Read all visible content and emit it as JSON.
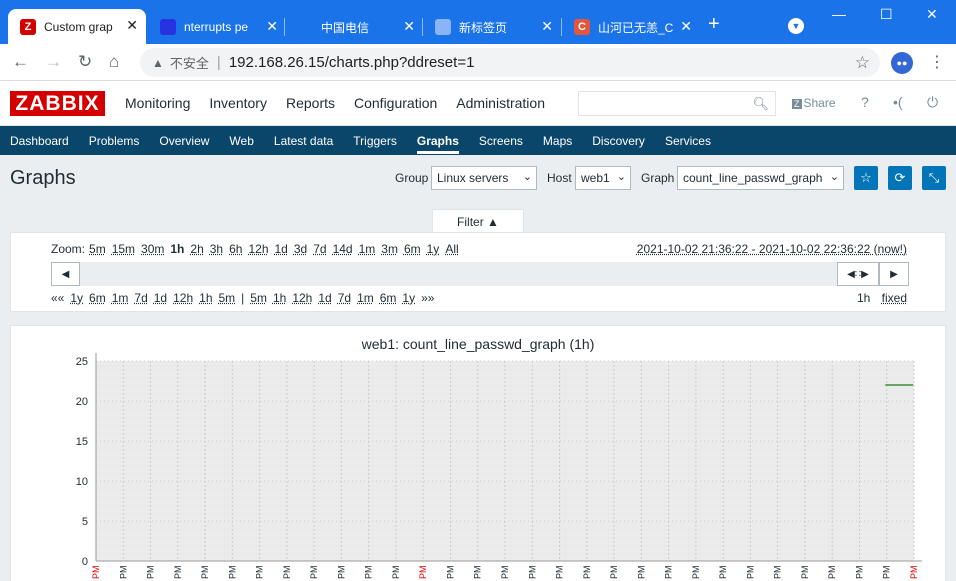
{
  "browser": {
    "tabs": [
      {
        "title": "Custom grap",
        "icon": "zabbix-z-icon",
        "icon_text": "Z",
        "icon_color": "#d40000",
        "active": true
      },
      {
        "title": "nterrupts pe",
        "icon": "baidu-paw-icon",
        "icon_text": "",
        "icon_color": "#2932e1",
        "active": false
      },
      {
        "title": "中国电信",
        "icon": "telecom-icon",
        "icon_text": "",
        "icon_color": "#1a73e8",
        "active": false
      },
      {
        "title": "新标签页",
        "icon": "chrome-newtab-icon",
        "icon_text": "",
        "icon_color": "#8ab4f8",
        "active": false
      },
      {
        "title": "山河已无恙_C",
        "icon": "csdn-c-icon",
        "icon_text": "C",
        "icon_color": "#e3563b",
        "active": false
      }
    ],
    "address": {
      "insecure_label": "不安全",
      "url": "192.168.26.15/charts.php?ddreset=1"
    }
  },
  "zabbix": {
    "logo": "ZABBIX",
    "main_menu": [
      "Monitoring",
      "Inventory",
      "Reports",
      "Configuration",
      "Administration"
    ],
    "share": "Share",
    "sub_menu": [
      "Dashboard",
      "Problems",
      "Overview",
      "Web",
      "Latest data",
      "Triggers",
      "Graphs",
      "Screens",
      "Maps",
      "Discovery",
      "Services"
    ],
    "selected_sub": "Graphs",
    "page_title": "Graphs",
    "filters": {
      "group_label": "Group",
      "group_value": "Linux servers",
      "host_label": "Host",
      "host_value": "web1",
      "graph_label": "Graph",
      "graph_value": "count_line_passwd_graph"
    },
    "filter_tab": "Filter ▲",
    "zoom_label": "Zoom:",
    "zoom_options": [
      "5m",
      "15m",
      "30m",
      "1h",
      "2h",
      "3h",
      "6h",
      "12h",
      "1d",
      "3d",
      "7d",
      "14d",
      "1m",
      "3m",
      "6m",
      "1y",
      "All"
    ],
    "zoom_current": "1h",
    "period_text": "2021-10-02 21:36:22 - 2021-10-02 22:36:22 (now!)",
    "nav_back_label": "««",
    "nav_back": [
      "1y",
      "6m",
      "1m",
      "7d",
      "1d",
      "12h",
      "1h",
      "5m"
    ],
    "nav_fwd": [
      "5m",
      "1h",
      "12h",
      "1d",
      "7d",
      "1m",
      "6m",
      "1y"
    ],
    "nav_fwd_label": "»»",
    "period_len": "1h",
    "fixed_label": "fixed"
  },
  "chart_data": {
    "type": "line",
    "title": "web1: count_line_passwd_graph (1h)",
    "ylim": [
      0,
      25
    ],
    "yticks": [
      0,
      5,
      10,
      15,
      20,
      25
    ],
    "series": [
      {
        "values": [
          22,
          22
        ],
        "color": "#1a7c11"
      }
    ],
    "series_x_fraction": [
      0.965,
      0.999
    ],
    "x_tick_label": "PM",
    "x_tick_count": 31,
    "x_tick_highlight": [
      0,
      12,
      30
    ],
    "colors": {
      "plot_bg": "#ebebeb",
      "grid": "#cccccc",
      "tick_normal": "#1f2c33",
      "tick_highlight": "#dd0000"
    }
  }
}
